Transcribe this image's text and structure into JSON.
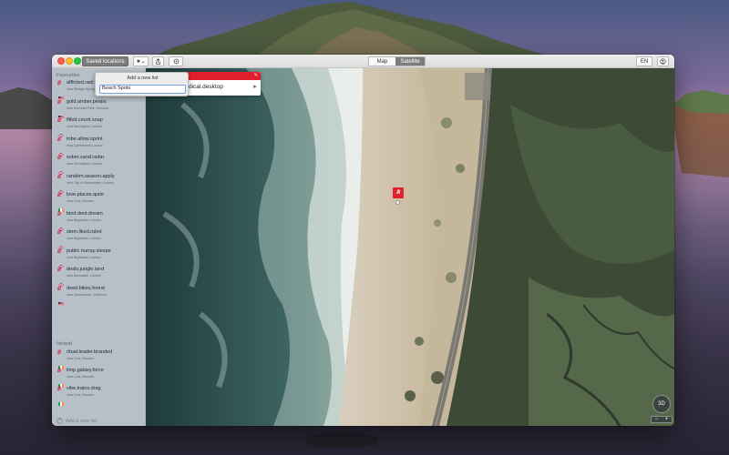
{
  "toolbar": {
    "saved_locations_label": "Saved locations",
    "star_label": "★⌄",
    "share_icon": "share-icon",
    "copy_icon": "copy-icon",
    "map_mode_map": "Map",
    "map_mode_satellite": "Satellite",
    "selected_mode": "Satellite",
    "language_label": "EN",
    "account_icon": "user-icon"
  },
  "sidebar": {
    "favourites_title": "Favourites",
    "favourites": [
      {
        "name": "afflicted.radi",
        "sub": "near Shingle Springs, Mountain",
        "country": "us"
      },
      {
        "name": "gold.amber.peeps",
        "sub": "near Kapiolani Park, Honolulu",
        "country": "us"
      },
      {
        "name": "filled.count.soap",
        "sub": "near Kensington, London",
        "country": "gb"
      },
      {
        "name": "tribe.allow.sprint",
        "sub": "near Camberwell, London",
        "country": "gb"
      },
      {
        "name": "sober.sand.radar",
        "sub": "near Kensington, London",
        "country": "gb"
      },
      {
        "name": "random.season.apply",
        "sub": "near City of Westminster, London",
        "country": "gb"
      },
      {
        "name": "love.places.quite",
        "sub": "near Cork, Munster",
        "country": "ie"
      },
      {
        "name": "bind.dent.dream",
        "sub": "near Bayswater, London",
        "country": "gb"
      },
      {
        "name": "stem.liked.ruled",
        "sub": "near Bayswater, London",
        "country": "gb"
      },
      {
        "name": "public.hurray.sleeps",
        "sub": "near Bayswater, London",
        "country": "gb"
      },
      {
        "name": "deals.jungle.land",
        "sub": "near Bayswater, London",
        "country": "gb"
      },
      {
        "name": "deed.bikes.forest",
        "sub": "near Sacramento, California",
        "country": "us"
      }
    ],
    "ireland_title": "Ireland",
    "ireland": [
      {
        "name": "ritual.leader.branded",
        "sub": "near Cork, Munster",
        "country": "ie"
      },
      {
        "name": "limp.galaxy.force",
        "sub": "near Cork, Munster",
        "country": "ie"
      },
      {
        "name": "vibe.trains.drag",
        "sub": "near Cork, Munster",
        "country": "ie"
      }
    ],
    "add_new_list_label": "Add a new list"
  },
  "popover": {
    "title": "Add a new list",
    "input_value": "Beach Spots"
  },
  "card": {
    "words": "dical.desktop",
    "edit_icon": "pencil-icon",
    "navigate_icon": "navigate-icon"
  },
  "map": {
    "marker_label": "///",
    "three_d_label": "3D",
    "zoom_out_label": "−",
    "zoom_in_label": "+"
  },
  "colors": {
    "brand_red": "#e0202c",
    "selected_toggle": "#7c7c7c"
  }
}
